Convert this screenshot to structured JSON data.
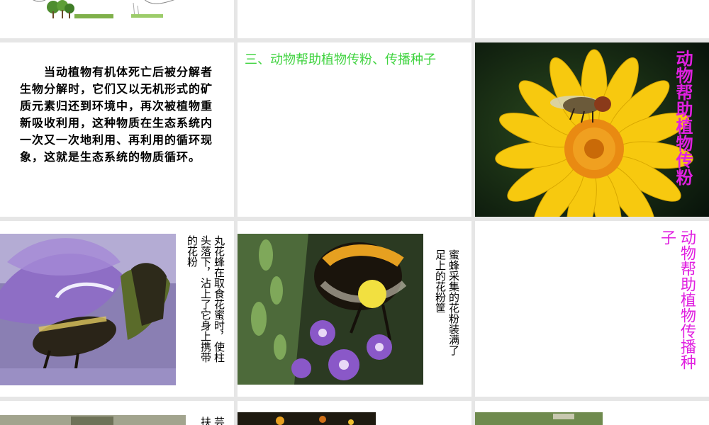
{
  "paragraph": "　　当动植物有机体死亡后被分解者生物分解时，它们又以无机形式的矿质元素归还到环境中，再次被植物重新吸收利用，这种物质在生态系统内一次又一次地利用、再利用的循环现象，这就是生态系统的物质循环。",
  "section_heading": "三、动物帮助植物传粉、传播种子",
  "vertical_title_1": "动物帮助植物传粉",
  "vertical_title_2_col1": "动物帮助植物传播种",
  "vertical_title_2_col2": "子",
  "caption_1_col1": "丸花蜂在取食花蜜时，使柱",
  "caption_1_col2": "头落下，沾上了它身上携带",
  "caption_1_col3": "的花粉",
  "caption_2_col1": "蜜蜂采集的花粉装满了",
  "caption_2_col2": "足上的花粉筐",
  "caption_3_col1": "芸",
  "caption_3_col2": "扶",
  "colors": {
    "heading_green": "#3fd33f",
    "title_magenta": "#e020e0",
    "text": "#000000",
    "grid": "#e6e6e6"
  }
}
